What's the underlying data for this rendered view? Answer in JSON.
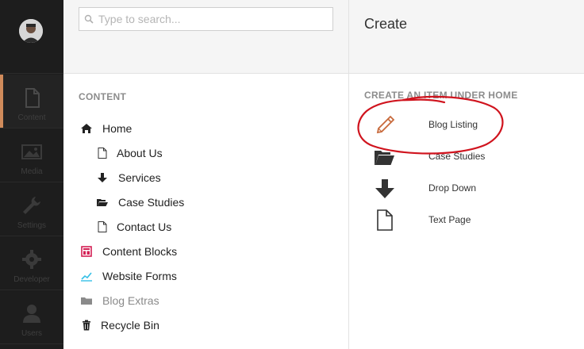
{
  "sidebar": {
    "items": [
      {
        "label": "Content",
        "icon": "document-icon",
        "active": true
      },
      {
        "label": "Media",
        "icon": "image-icon",
        "active": false
      },
      {
        "label": "Settings",
        "icon": "wrench-icon",
        "active": false
      },
      {
        "label": "Developer",
        "icon": "gear-icon",
        "active": false
      },
      {
        "label": "Users",
        "icon": "user-icon",
        "active": false
      }
    ],
    "accent_color": "#d08b5b"
  },
  "search": {
    "placeholder": "Type to search..."
  },
  "tree": {
    "section_title": "CONTENT",
    "items": [
      {
        "label": "Home",
        "icon": "home-icon"
      },
      {
        "label": "About Us",
        "icon": "document-icon"
      },
      {
        "label": "Services",
        "icon": "arrow-down-icon"
      },
      {
        "label": "Case Studies",
        "icon": "folder-open-icon"
      },
      {
        "label": "Contact Us",
        "icon": "document-icon"
      },
      {
        "label": "Content Blocks",
        "icon": "layout-icon",
        "color": "#d42054"
      },
      {
        "label": "Website Forms",
        "icon": "chart-line-icon",
        "color": "#35c0e6"
      },
      {
        "label": "Blog Extras",
        "icon": "folder-icon",
        "muted": true
      },
      {
        "label": "Recycle Bin",
        "icon": "trash-icon"
      }
    ]
  },
  "create": {
    "title": "Create",
    "section_title": "CREATE AN ITEM UNDER HOME",
    "items": [
      {
        "label": "Blog Listing",
        "icon": "pencil-icon"
      },
      {
        "label": "Case Studies",
        "icon": "folder-open-icon"
      },
      {
        "label": "Drop Down",
        "icon": "arrow-down-icon"
      },
      {
        "label": "Text Page",
        "icon": "document-icon"
      }
    ],
    "annotation_color": "#d0141e"
  }
}
